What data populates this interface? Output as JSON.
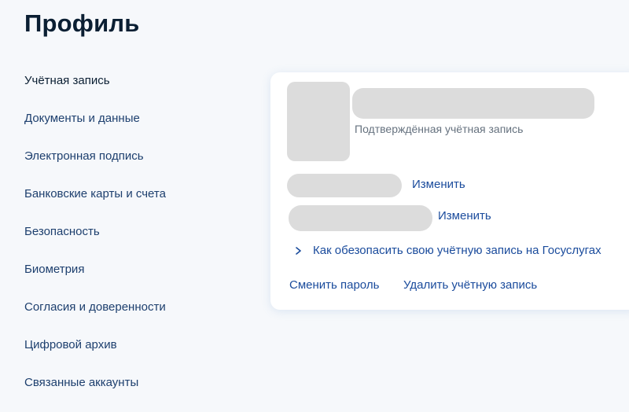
{
  "page": {
    "title": "Профиль"
  },
  "sidebar": {
    "items": [
      {
        "label": "Учётная запись",
        "active": true
      },
      {
        "label": "Документы и данные"
      },
      {
        "label": "Электронная подпись"
      },
      {
        "label": "Банковские карты и счета"
      },
      {
        "label": "Безопасность"
      },
      {
        "label": "Биометрия"
      },
      {
        "label": "Согласия и доверенности"
      },
      {
        "label": "Цифровой архив"
      },
      {
        "label": "Связанные аккаунты"
      }
    ]
  },
  "account_card": {
    "status_label": "Подтверждённая учётная запись",
    "phone_change_label": "Изменить",
    "email_change_label": "Изменить",
    "security_tip_label": "Как обезопасить свою учётную запись на Госуслугах",
    "change_password_label": "Сменить пароль",
    "delete_account_label": "Удалить учётную запись"
  },
  "icons": {
    "chevron": "chevron-right-icon"
  },
  "colors": {
    "background": "#f6f8fb",
    "link": "#1a4b9c",
    "title": "#0b1f33",
    "muted_text": "#66727f",
    "skeleton": "#dcdcdc"
  }
}
